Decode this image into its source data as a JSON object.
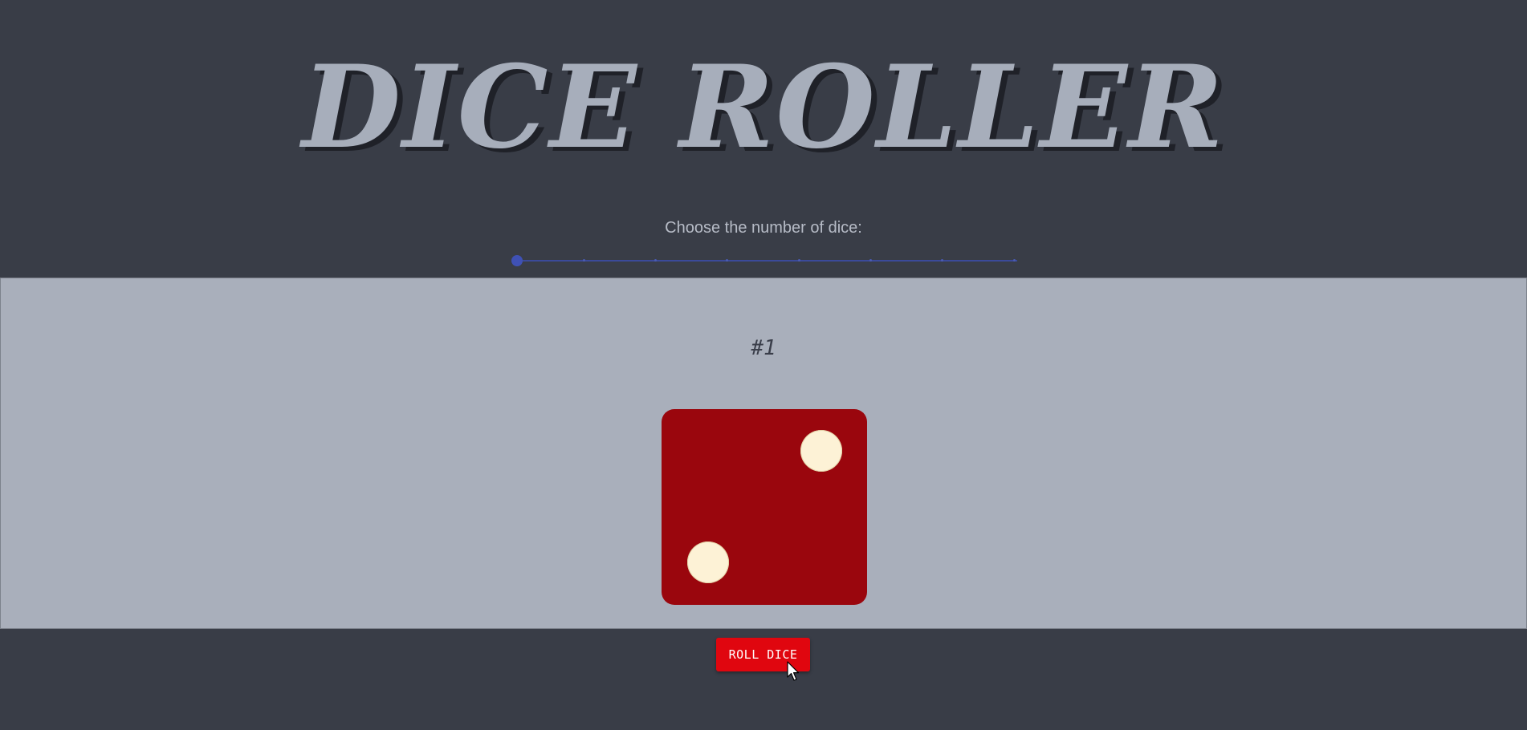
{
  "header": {
    "title": "DICE ROLLER",
    "prompt": "Choose the number of dice:"
  },
  "dice_count_slider": {
    "value": 1,
    "min": 1,
    "max": 8
  },
  "dice_panel": {
    "dice": [
      {
        "label": "#1",
        "face_value": 2,
        "color": "#9a060d",
        "pip_color": "#fdf2d6"
      }
    ]
  },
  "roll_button": {
    "label": "ROLL DICE",
    "color": "#e0060f"
  },
  "colors": {
    "background": "#393d47",
    "panel": "#a9afbb",
    "title": "#a7aebb",
    "slider_accent": "#3f51b5"
  }
}
